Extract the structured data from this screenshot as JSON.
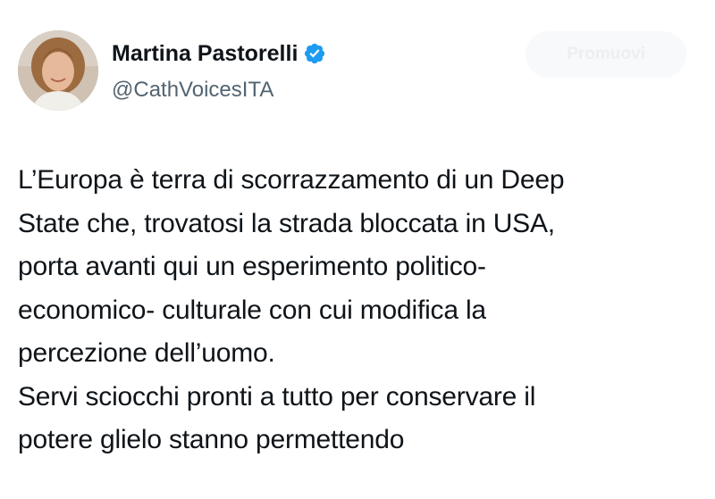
{
  "author": {
    "name": "Martina Pastorelli",
    "handle": "@CathVoicesITA",
    "verified": true,
    "verified_icon": "verified-badge-icon",
    "verified_color": "#1d9bf0"
  },
  "follow_button": {
    "label": "Promuovi"
  },
  "tweet": {
    "lines": [
      "L’Europa è terra di scorrazzamento di un Deep",
      "State che, trovatosi la strada bloccata in USA,",
      "porta avanti qui un esperimento politico-",
      "economico- culturale con cui modifica la",
      "percezione dell’uomo.",
      "Servi sciocchi pronti a tutto per conservare il",
      "potere  glielo stanno permettendo"
    ]
  }
}
